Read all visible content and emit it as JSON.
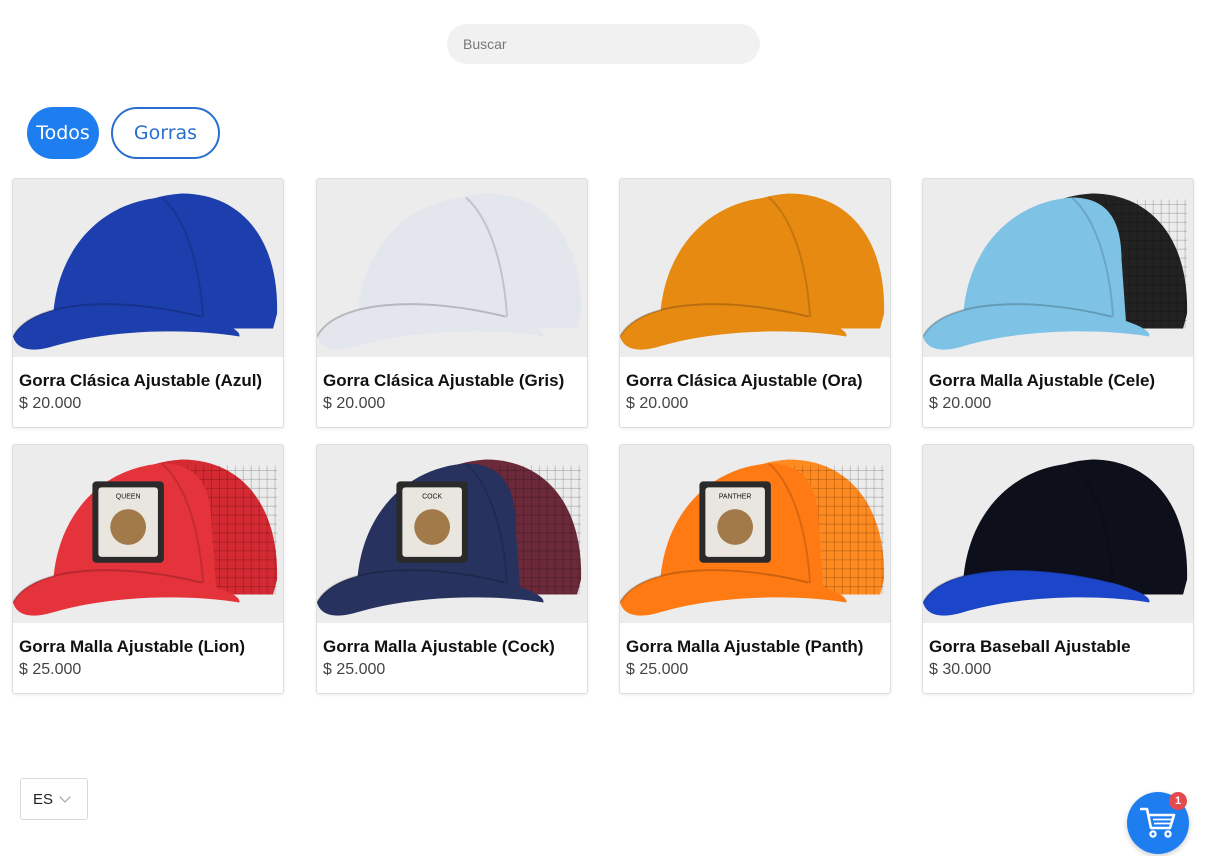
{
  "search": {
    "placeholder": "Buscar",
    "value": ""
  },
  "filters": [
    {
      "label": "Todos",
      "active": true
    },
    {
      "label": "Gorras",
      "active": false
    }
  ],
  "products": [
    {
      "name": "Gorra Clásica Ajustable (Azul)",
      "price": "$ 20.000",
      "cap_color": "#1d3fae",
      "mesh_color": "#1d3fae",
      "patch": ""
    },
    {
      "name": "Gorra Clásica Ajustable (Gris)",
      "price": "$ 20.000",
      "cap_color": "#e4e6ee",
      "mesh_color": "#e4e6ee",
      "patch": ""
    },
    {
      "name": "Gorra Clásica Ajustable (Ora)",
      "price": "$ 20.000",
      "cap_color": "#e68a12",
      "mesh_color": "#e68a12",
      "patch": ""
    },
    {
      "name": "Gorra Malla Ajustable (Cele)",
      "price": "$ 20.000",
      "cap_color": "#7ec3e6",
      "mesh_color": "#222222",
      "patch": ""
    },
    {
      "name": "Gorra Malla Ajustable (Lion)",
      "price": "$ 25.000",
      "cap_color": "#e5333b",
      "mesh_color": "#d42a33",
      "patch": "QUEEN"
    },
    {
      "name": "Gorra Malla Ajustable (Cock)",
      "price": "$ 25.000",
      "cap_color": "#27325e",
      "mesh_color": "#6b2a3a",
      "patch": "COCK"
    },
    {
      "name": "Gorra Malla Ajustable (Panth)",
      "price": "$ 25.000",
      "cap_color": "#ff7a12",
      "mesh_color": "#ff8a20",
      "patch": "PANTHER"
    },
    {
      "name": "Gorra Baseball Ajustable",
      "price": "$ 30.000",
      "cap_color": "#0d0f1a",
      "mesh_color": "#0d0f1a",
      "brim_color": "#1c46c9",
      "patch": ""
    }
  ],
  "language": {
    "selected": "ES"
  },
  "cart": {
    "count": "1"
  },
  "colors": {
    "accent": "#1e7ef0",
    "badge": "#e5484d"
  }
}
